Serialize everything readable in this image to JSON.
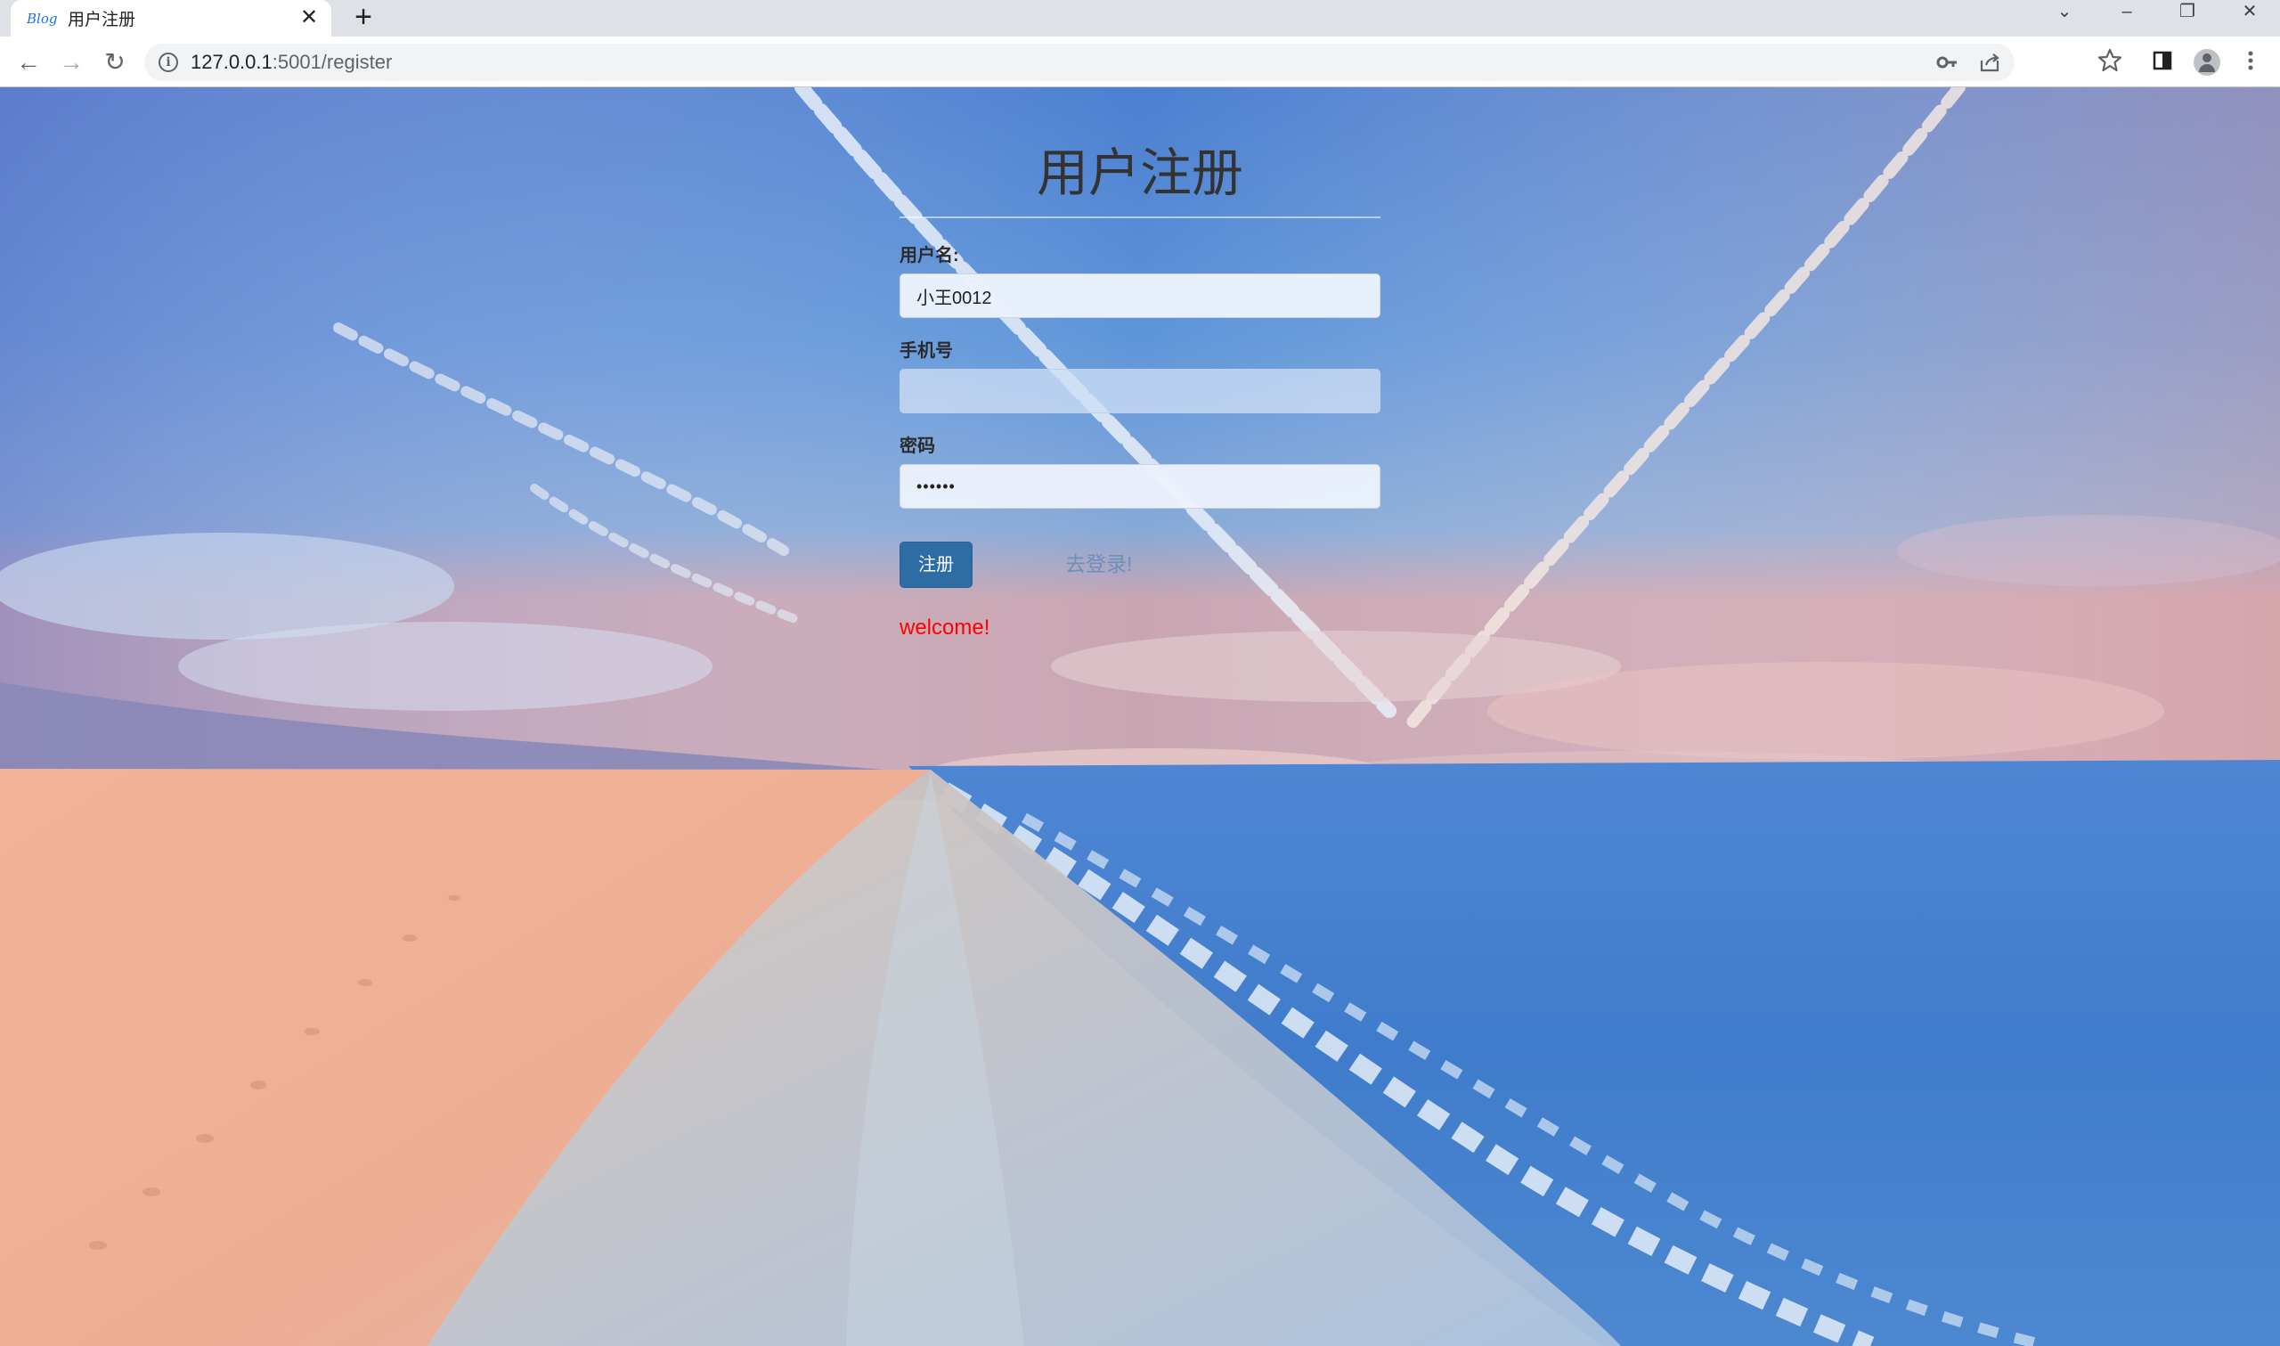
{
  "browser": {
    "tab": {
      "favicon_text": "Blog",
      "title": "用户注册",
      "close_glyph": "✕"
    },
    "new_tab_glyph": "+",
    "window_controls": {
      "dropdown": "⌄",
      "minimize": "–",
      "restore": "❐",
      "close": "✕"
    },
    "nav": {
      "back": "←",
      "forward": "→",
      "reload": "↻"
    },
    "address": {
      "host": "127.0.0.1",
      "path": ":5001/register"
    },
    "icons": [
      "key-icon",
      "share-icon",
      "star-icon",
      "sidebar-icon",
      "avatar-icon",
      "menu-icon"
    ]
  },
  "page": {
    "title": "用户注册",
    "username_label": "用户名:",
    "username_value": "小王0012",
    "phone_label": "手机号",
    "phone_value": "",
    "password_label": "密码",
    "password_value": "••••••",
    "register_button": "注册",
    "login_link": "去登录!",
    "welcome_text": "welcome!"
  },
  "colors": {
    "primary_button": "#2e6da4",
    "welcome": "#ff0000",
    "title": "#333333"
  }
}
